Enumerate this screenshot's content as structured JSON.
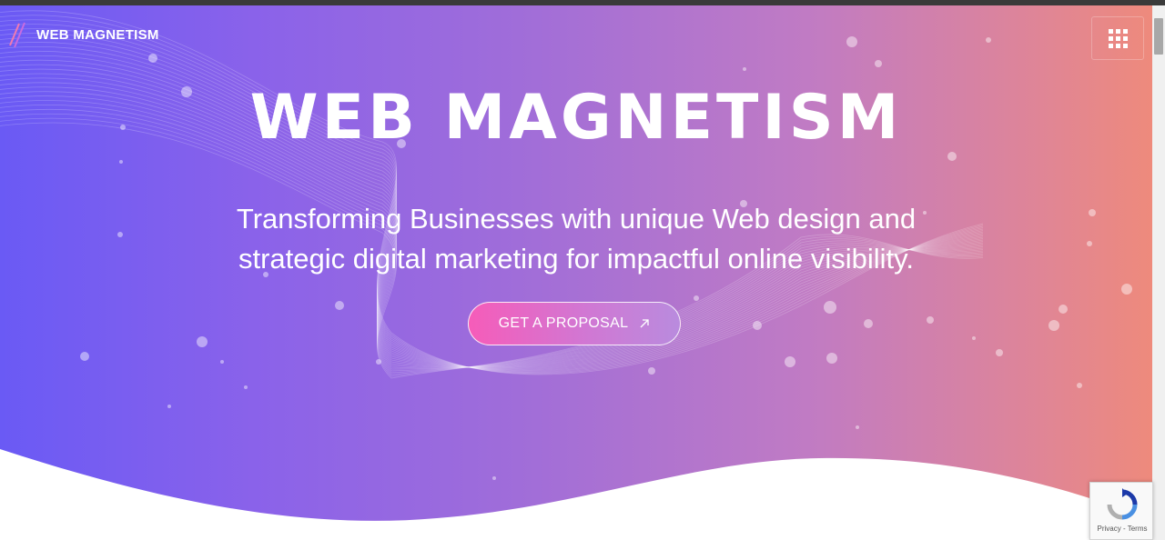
{
  "brand": {
    "logo_text": "WEB MAGNETISM"
  },
  "header": {
    "menu_icon": "grid-menu-icon"
  },
  "hero": {
    "headline": "WEB MAGNETISM",
    "subheadline_line1": "Transforming Businesses with unique Web design and",
    "subheadline_line2": "strategic digital marketing for impactful online visibility.",
    "cta_label": "GET A PROPOSAL",
    "cta_icon": "arrow-up-right-icon"
  },
  "recaptcha": {
    "terms_text": "Privacy - Terms"
  },
  "colors": {
    "gradient_start": "#6a5af5",
    "gradient_end": "#ee8a7c",
    "cta_pink": "#f65cb9"
  }
}
